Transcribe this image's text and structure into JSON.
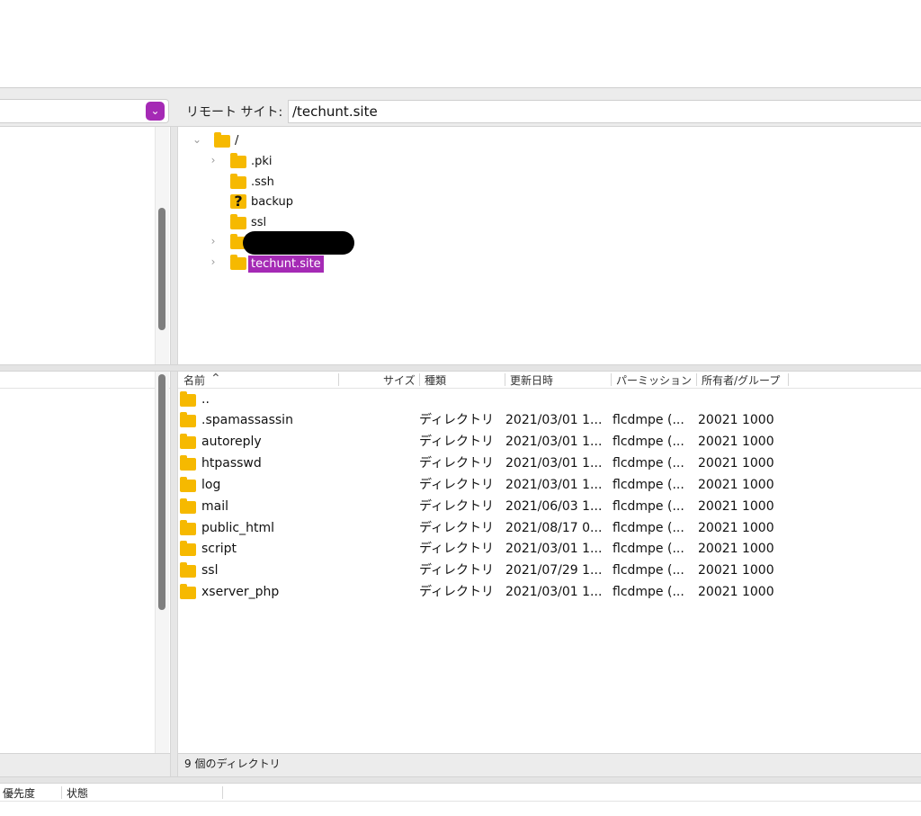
{
  "toolbar": {
    "remote_label": "リモート サイト:",
    "remote_path": "/techunt.site"
  },
  "remote_tree": {
    "root": "/",
    "items": [
      {
        "label": ".pki",
        "expandable": true,
        "icon": "folder-icon"
      },
      {
        "label": ".ssh",
        "expandable": false,
        "icon": "folder-icon"
      },
      {
        "label": "backup",
        "expandable": false,
        "icon": "unknown-folder-icon"
      },
      {
        "label": "ssl",
        "expandable": false,
        "icon": "folder-icon"
      },
      {
        "label": "",
        "expandable": true,
        "icon": "folder-icon",
        "redacted": true
      },
      {
        "label": "techunt.site",
        "expandable": true,
        "icon": "folder-icon",
        "selected": true
      }
    ]
  },
  "list": {
    "columns": {
      "name": "名前",
      "size": "サイズ",
      "type": "種類",
      "modified": "更新日時",
      "perms": "パーミッション",
      "owner": "所有者/グループ"
    },
    "parent": "..",
    "rows": [
      {
        "name": ".spamassassin",
        "type": "ディレクトリ",
        "modified": "2021/03/01 1...",
        "perms": "flcdmpe (...",
        "owner": "20021 1000"
      },
      {
        "name": "autoreply",
        "type": "ディレクトリ",
        "modified": "2021/03/01 1...",
        "perms": "flcdmpe (...",
        "owner": "20021 1000"
      },
      {
        "name": "htpasswd",
        "type": "ディレクトリ",
        "modified": "2021/03/01 1...",
        "perms": "flcdmpe (...",
        "owner": "20021 1000"
      },
      {
        "name": "log",
        "type": "ディレクトリ",
        "modified": "2021/03/01 1...",
        "perms": "flcdmpe (...",
        "owner": "20021 1000"
      },
      {
        "name": "mail",
        "type": "ディレクトリ",
        "modified": "2021/06/03 1...",
        "perms": "flcdmpe (...",
        "owner": "20021 1000"
      },
      {
        "name": "public_html",
        "type": "ディレクトリ",
        "modified": "2021/08/17 0...",
        "perms": "flcdmpe (...",
        "owner": "20021 1000"
      },
      {
        "name": "script",
        "type": "ディレクトリ",
        "modified": "2021/03/01 1...",
        "perms": "flcdmpe (...",
        "owner": "20021 1000"
      },
      {
        "name": "ssl",
        "type": "ディレクトリ",
        "modified": "2021/07/29 1...",
        "perms": "flcdmpe (...",
        "owner": "20021 1000"
      },
      {
        "name": "xserver_php",
        "type": "ディレクトリ",
        "modified": "2021/03/01 1...",
        "perms": "flcdmpe (...",
        "owner": "20021 1000"
      }
    ]
  },
  "status": {
    "remote": "9 個のディレクトリ"
  },
  "queue": {
    "priority": "優先度",
    "state": "状態"
  },
  "colors": {
    "accent": "#a52ab5",
    "folder": "#f6b900"
  }
}
